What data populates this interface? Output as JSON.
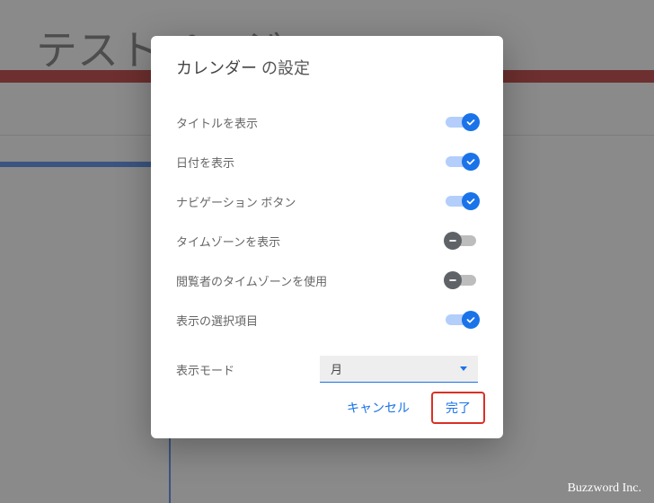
{
  "backdrop": {
    "page_title": "テストページ"
  },
  "dialog": {
    "title_prefix": "カレンダー",
    "title_suffix": " の設定",
    "settings": [
      {
        "label": "タイトルを表示",
        "on": true
      },
      {
        "label": "日付を表示",
        "on": true
      },
      {
        "label": "ナビゲーション ボタン",
        "on": true
      },
      {
        "label": "タイムゾーンを表示",
        "on": false
      },
      {
        "label": "閲覧者のタイムゾーンを使用",
        "on": false
      },
      {
        "label": "表示の選択項目",
        "on": true
      }
    ],
    "mode_label": "表示モード",
    "mode_value": "月",
    "cancel_label": "キャンセル",
    "done_label": "完了"
  },
  "watermark": "Buzzword Inc."
}
